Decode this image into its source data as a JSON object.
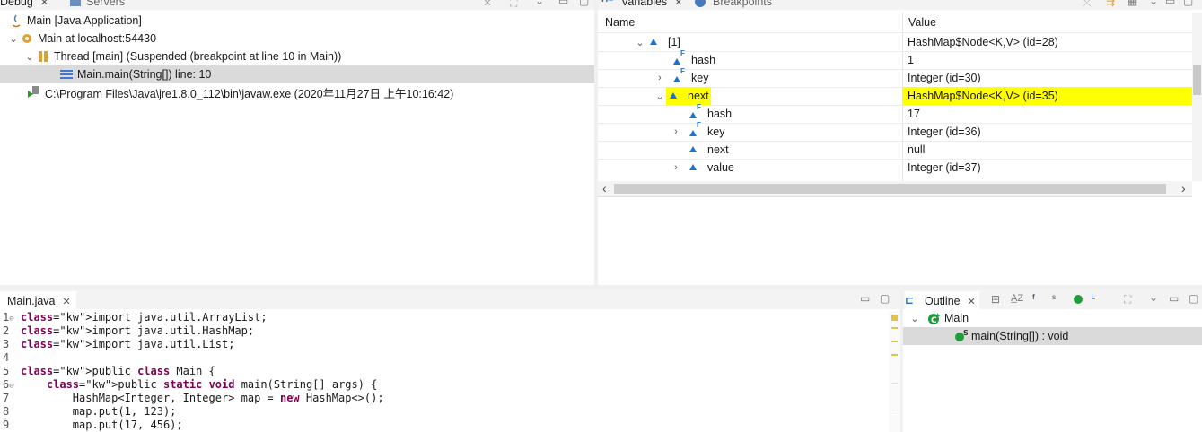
{
  "debug_view": {
    "tabs": [
      "Debug",
      "Servers"
    ],
    "tree": [
      {
        "label": "Main [Java Application]",
        "icon": "java-app-icon"
      },
      {
        "label": "Main at localhost:54430",
        "icon": "debug-target-icon"
      },
      {
        "label": "Thread [main] (Suspended (breakpoint at line 10 in Main))",
        "icon": "suspended-thread-icon"
      },
      {
        "label": "Main.main(String[]) line: 10",
        "icon": "stack-frame-icon"
      },
      {
        "label": "C:\\Program Files\\Java\\jre1.8.0_112\\bin\\javaw.exe (2020年11月27日 上午10:16:42)",
        "icon": "process-icon"
      }
    ]
  },
  "variables_view": {
    "tabs": [
      "Variables",
      "Breakpoints"
    ],
    "columns": [
      "Name",
      "Value"
    ],
    "rows": [
      {
        "name": "[1]",
        "value": "HashMap$Node<K,V>  (id=28)",
        "expander": "expanded",
        "icon": "field-icon"
      },
      {
        "name": "hash",
        "value": "1",
        "expander": "none",
        "icon": "final-field-icon"
      },
      {
        "name": "key",
        "value": "Integer  (id=30)",
        "expander": "collapsed",
        "icon": "final-field-icon"
      },
      {
        "name": "next",
        "value": "HashMap$Node<K,V>  (id=35)",
        "expander": "expanded",
        "icon": "field-icon",
        "highlight": true
      },
      {
        "name": "hash",
        "value": "17",
        "expander": "none",
        "icon": "final-field-icon"
      },
      {
        "name": "key",
        "value": "Integer  (id=36)",
        "expander": "collapsed",
        "icon": "final-field-icon"
      },
      {
        "name": "next",
        "value": "null",
        "expander": "none",
        "icon": "field-icon"
      },
      {
        "name": "value",
        "value": "Integer  (id=37)",
        "expander": "collapsed",
        "icon": "field-icon"
      }
    ],
    "highlight_color": "#ffff00"
  },
  "editor": {
    "tab": "Main.java",
    "lines": [
      {
        "n": "1",
        "text": "import java.util.ArrayList;"
      },
      {
        "n": "2",
        "text": "import java.util.HashMap;"
      },
      {
        "n": "3",
        "text": "import java.util.List;"
      },
      {
        "n": "4",
        "text": ""
      },
      {
        "n": "5",
        "text": "public class Main {"
      },
      {
        "n": "6",
        "text": "    public static void main(String[] args) {"
      },
      {
        "n": "7",
        "text": "        HashMap<Integer, Integer> map = new HashMap<>();"
      },
      {
        "n": "8",
        "text": "        map.put(1, 123);"
      },
      {
        "n": "9",
        "text": "        map.put(17, 456);"
      }
    ]
  },
  "outline": {
    "tab": "Outline",
    "items": [
      {
        "label": "Main",
        "icon": "class-icon"
      },
      {
        "label": "main(String[]) : void",
        "icon": "static-method-icon"
      }
    ]
  }
}
